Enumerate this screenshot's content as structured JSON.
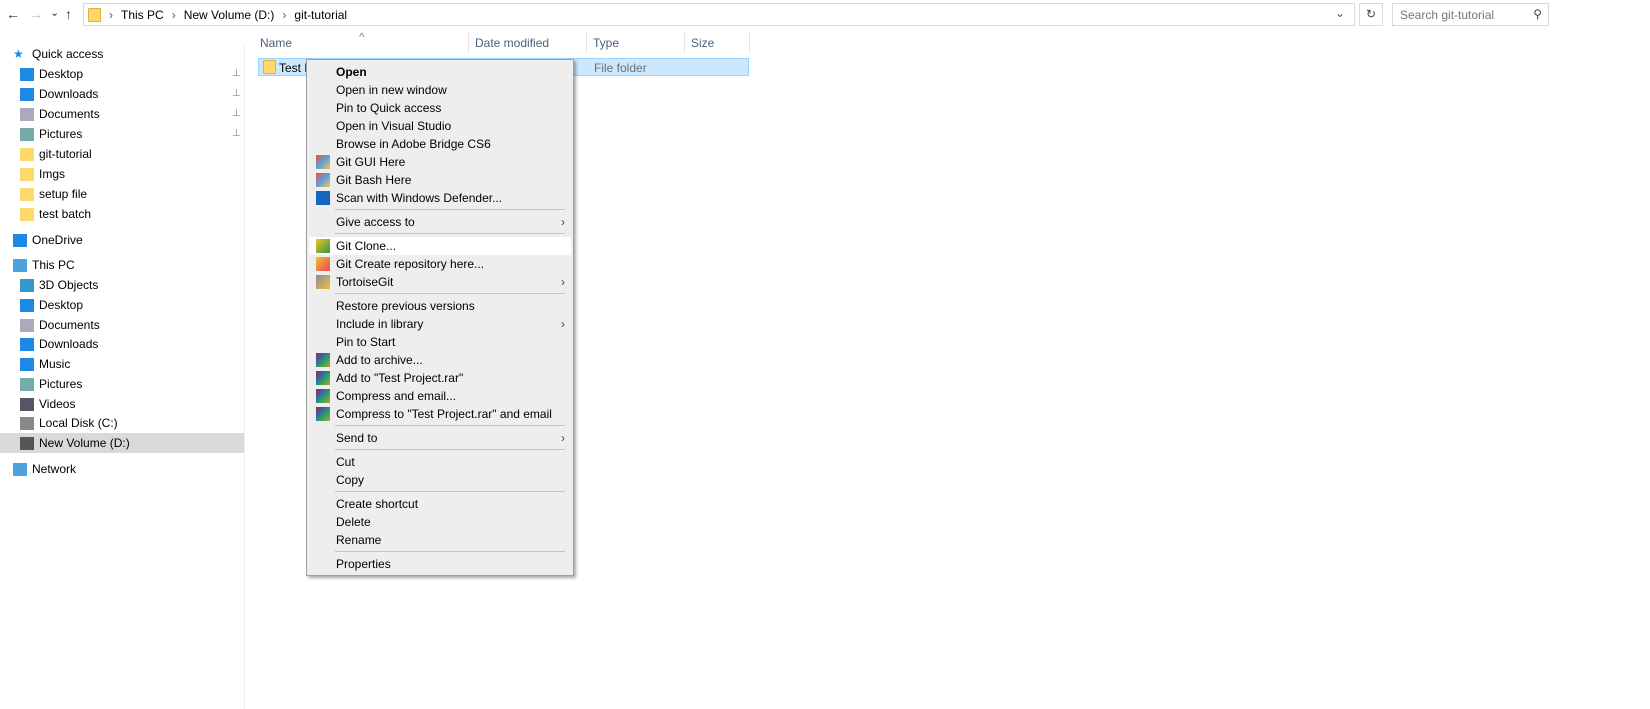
{
  "nav": {
    "back": "←",
    "forward": "→",
    "recent": "⌄",
    "up": "↑"
  },
  "address": {
    "crumbs": [
      "This PC",
      "New Volume (D:)",
      "git-tutorial"
    ],
    "sep": "›",
    "dropdown": "⌄",
    "refresh": "↻"
  },
  "search": {
    "placeholder": "Search git-tutorial",
    "icon": "⚲"
  },
  "sidebar": {
    "items": [
      {
        "label": "Quick access",
        "icon": "star-icon",
        "color": "#1e88e5"
      },
      {
        "label": "Desktop",
        "icon": "desktop-icon",
        "color": "#1e88e5",
        "pinned": true
      },
      {
        "label": "Downloads",
        "icon": "download-icon",
        "color": "#1e88e5",
        "pinned": true
      },
      {
        "label": "Documents",
        "icon": "document-icon",
        "color": "#aab",
        "pinned": true
      },
      {
        "label": "Pictures",
        "icon": "pictures-icon",
        "color": "#7aa",
        "pinned": true
      },
      {
        "label": "git-tutorial",
        "icon": "folder-icon",
        "color": "#ffd96b"
      },
      {
        "label": "Imgs",
        "icon": "folder-icon",
        "color": "#ffd96b"
      },
      {
        "label": "setup file",
        "icon": "folder-icon",
        "color": "#ffd96b"
      },
      {
        "label": "test batch",
        "icon": "folder-icon",
        "color": "#ffd96b"
      },
      {
        "label": "OneDrive",
        "icon": "cloud-icon",
        "color": "#1e88e5"
      },
      {
        "label": "This PC",
        "icon": "computer-icon",
        "color": "#4aa3df"
      },
      {
        "label": "3D Objects",
        "icon": "cube-icon",
        "color": "#39c"
      },
      {
        "label": "Desktop",
        "icon": "desktop-icon",
        "color": "#1e88e5"
      },
      {
        "label": "Documents",
        "icon": "document-icon",
        "color": "#aab"
      },
      {
        "label": "Downloads",
        "icon": "download-icon",
        "color": "#1e88e5"
      },
      {
        "label": "Music",
        "icon": "music-icon",
        "color": "#1e88e5"
      },
      {
        "label": "Pictures",
        "icon": "pictures-icon",
        "color": "#7aa"
      },
      {
        "label": "Videos",
        "icon": "video-icon",
        "color": "#556"
      },
      {
        "label": "Local Disk (C:)",
        "icon": "drive-icon",
        "color": "#888"
      },
      {
        "label": "New Volume (D:)",
        "icon": "drive-icon",
        "color": "#555",
        "selected": true
      },
      {
        "label": "Network",
        "icon": "network-icon",
        "color": "#4aa3df"
      }
    ]
  },
  "columns": {
    "sort": "^",
    "headers": [
      "Name",
      "Date modified",
      "Type",
      "Size"
    ]
  },
  "files": [
    {
      "name": "Test Project",
      "type": "File folder"
    }
  ],
  "menu": {
    "pin": "📌",
    "items": [
      {
        "label": "Open",
        "bold": true
      },
      {
        "label": "Open in new window"
      },
      {
        "label": "Pin to Quick access"
      },
      {
        "label": "Open in Visual Studio"
      },
      {
        "label": "Browse in Adobe Bridge CS6"
      },
      {
        "label": "Git GUI Here",
        "icon": "git-icon"
      },
      {
        "label": "Git Bash Here",
        "icon": "git-icon"
      },
      {
        "label": "Scan with Windows Defender...",
        "icon": "defender-icon"
      },
      {
        "sep": true
      },
      {
        "label": "Give access to",
        "submenu": true
      },
      {
        "sep": true
      },
      {
        "label": "Git Clone...",
        "icon": "git-clone-icon",
        "highlight": true
      },
      {
        "label": "Git Create repository here...",
        "icon": "git-create-icon"
      },
      {
        "label": "TortoiseGit",
        "icon": "tortoisegit-icon",
        "submenu": true
      },
      {
        "sep": true
      },
      {
        "label": "Restore previous versions"
      },
      {
        "label": "Include in library",
        "submenu": true
      },
      {
        "label": "Pin to Start"
      },
      {
        "label": "Add to archive...",
        "icon": "winrar-icon"
      },
      {
        "label": "Add to \"Test Project.rar\"",
        "icon": "winrar-icon"
      },
      {
        "label": "Compress and email...",
        "icon": "winrar-icon"
      },
      {
        "label": "Compress to \"Test Project.rar\" and email",
        "icon": "winrar-icon"
      },
      {
        "sep": true
      },
      {
        "label": "Send to",
        "submenu": true
      },
      {
        "sep": true
      },
      {
        "label": "Cut"
      },
      {
        "label": "Copy"
      },
      {
        "sep": true
      },
      {
        "label": "Create shortcut"
      },
      {
        "label": "Delete"
      },
      {
        "label": "Rename"
      },
      {
        "sep": true
      },
      {
        "label": "Properties"
      }
    ],
    "submenu_arrow": "›"
  }
}
